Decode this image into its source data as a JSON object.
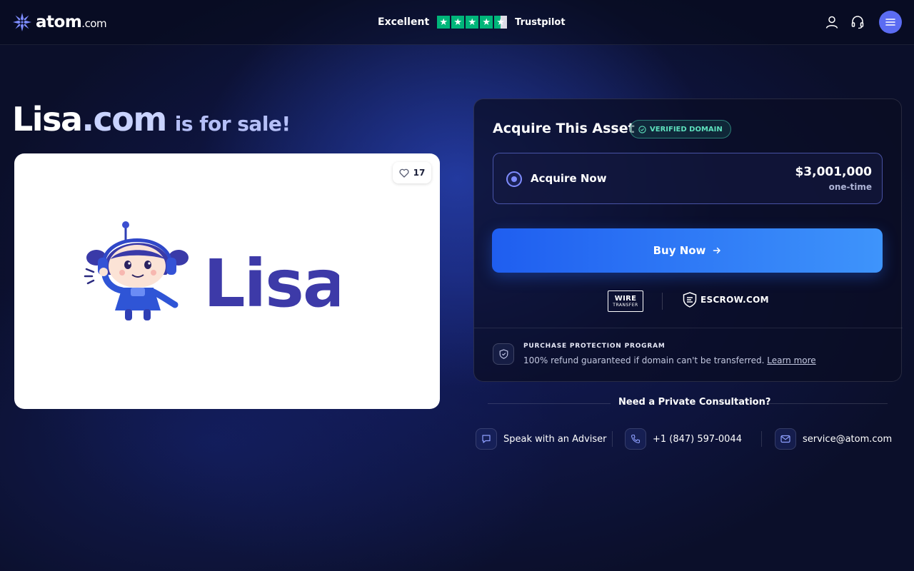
{
  "header": {
    "logo_text": "atom",
    "logo_tld": ".com",
    "trust": {
      "rating_label": "Excellent",
      "stars": 4.5,
      "brand": "Trustpilot",
      "star_color": "#00b67a"
    },
    "icons": [
      "user-icon",
      "headset-icon",
      "menu-icon"
    ]
  },
  "listing": {
    "domain_name": "Lisa",
    "domain_tld": ".com",
    "suffix": "is for sale!",
    "likes": "17",
    "logo_word": "Lisa"
  },
  "purchase_card": {
    "title": "Acquire This Asset",
    "badge": "VERIFIED DOMAIN",
    "option": {
      "label": "Acquire Now",
      "price": "$3,001,000",
      "term": "one-time",
      "selected": true
    },
    "buy_button": "Buy Now",
    "payments": {
      "wire_top": "WIRE",
      "wire_bottom": "TRANSFER",
      "escrow": "ESCROW.COM"
    },
    "protection": {
      "title": "PURCHASE PROTECTION PROGRAM",
      "text": "100% refund guaranteed if domain can't be transferred.",
      "link": "Learn more"
    }
  },
  "consultation": {
    "title": "Need a Private Consultation?",
    "contacts": [
      {
        "icon": "chat-icon",
        "label": "Speak with an Adviser"
      },
      {
        "icon": "phone-icon",
        "label": "+1 (847) 597-0044"
      },
      {
        "icon": "mail-icon",
        "label": "service@atom.com"
      }
    ]
  },
  "colors": {
    "background": "#0b0f2a",
    "accent": "#5b6cf2",
    "button_start": "#1f5ef0",
    "button_end": "#3e94fb",
    "verified": "#5ee0bd",
    "lisa_purple": "#3d3aa8"
  }
}
